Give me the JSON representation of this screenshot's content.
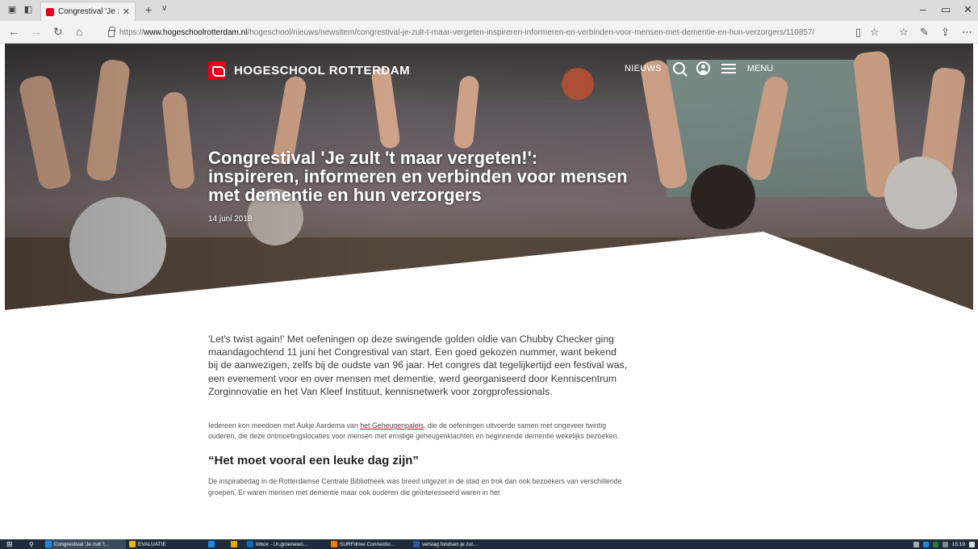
{
  "browser": {
    "tab_title": "Congrestival 'Je zult 't m",
    "url_prefix": "https://",
    "url_host": "www.hogeschoolrotterdam.nl",
    "url_path": "/hogeschool/nieuws/newsitem/congrestival-je-zult-t-maar-vergeten-inspireren-informeren-en-verbinden-voor-mensen-met-dementie-en-hun-verzorgers/110857/",
    "icons": [
      "back-icon",
      "forward-icon",
      "refresh-icon",
      "home-icon",
      "reading-view-icon",
      "favorite-star-icon",
      "favorites-hub-icon",
      "pen-icon",
      "share-icon",
      "more-icon"
    ]
  },
  "site": {
    "logo": "HOGESCHOOL ROTTERDAM",
    "nav_news": "NIEUWS",
    "nav_menu": "MENU",
    "brand_color": "#e2001a"
  },
  "hero": {
    "title": "Congrestival 'Je zult 't maar vergeten!': inspireren, informeren en verbinden voor mensen met dementie en hun verzorgers",
    "date": "14 juni 2018"
  },
  "article": {
    "lead": "'Let's twist again!' Met oefeningen op deze swingende golden oldie van Chubby Checker ging maandagochtend 11 juni het Congrestival van start. Een goed gekozen nummer, want bekend bij de aanwezigen, zelfs bij de oudste van 96 jaar. Het congres dat tegelijkertijd een festival was, een evenement voor en over mensen met dementie, werd georganiseerd door Kenniscentrum Zorginnovatie en het Van Kleef Instituut, kennisnetwerk voor zorgprofessionals.",
    "p2_before": "Iedereen kon meedoen met Aukje Aardema van ",
    "p2_link": "het Geheugenpaleis",
    "p2_after": ", die de oefeningen uitvoerde samen met ongeveer twintig ouderen, die deze ontmoetingslocaties voor mensen met ernstige geheugenklachten en beginnende dementie wekelijks bezoeken.",
    "heading": "“Het moet vooral een leuke dag zijn”",
    "p3": "De inspiratiedag in de Rotterdamse Centrale Bibliotheek was breed uitgezet in de stad en trok dan ook bezoekers van verschillende groepen. Er waren mensen met dementie maar ook ouderen die geïnteresseerd waren in het"
  },
  "taskbar": {
    "items": [
      {
        "label": "Congrestival 'Je zult 't...",
        "color": "#1e88e5"
      },
      {
        "label": "EVALUATIE",
        "color": "#f2b01e"
      },
      {
        "label": "",
        "color": "#1e88e5"
      },
      {
        "label": "",
        "color": "#e8a317"
      },
      {
        "label": "Inbox - i.h.groenewo...",
        "color": "#0f6cbd"
      },
      {
        "label": "SURFdrive Connectio...",
        "color": "#ef7d00"
      },
      {
        "label": "verslag fondsen je zul...",
        "color": "#2b579a"
      }
    ],
    "time": "15:19"
  }
}
